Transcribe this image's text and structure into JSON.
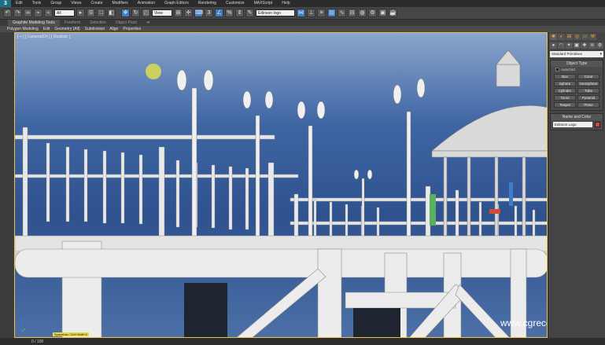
{
  "menubar": {
    "logo": "3",
    "items": [
      "Edit",
      "Tools",
      "Group",
      "Views",
      "Create",
      "Modifiers",
      "Animation",
      "Graph Editors",
      "Rendering",
      "Customize",
      "MAXScript",
      "Help"
    ]
  },
  "toolbar": {
    "selection_filter": "All",
    "reference_coord": "View",
    "named_selection": "Edinson logo"
  },
  "ribbon": {
    "tabs": [
      "Graphite Modeling Tools",
      "Freeform",
      "Selection",
      "Object Paint"
    ],
    "sub_items": [
      "Polygon Modeling",
      "Edit",
      "Geometry (All)",
      "Subdivision",
      "Align",
      "Properties"
    ]
  },
  "viewport": {
    "label": "[ + ] [ Camera004 ] [ Realistic ]",
    "watermark": "www.cgrecord.net",
    "mini_status": "Spacebar / Ctrl+Shift+X"
  },
  "command_panel": {
    "dropdown": "Standard Primitives",
    "object_type_title": "Object Type",
    "autogrid_label": "AutoGrid",
    "object_buttons": [
      "Box",
      "Cone",
      "Sphere",
      "GeoSphere",
      "Cylinder",
      "Tube",
      "Torus",
      "Pyramid",
      "Teapot",
      "Plane"
    ],
    "name_color_title": "Name and Color",
    "name_value": "Edinson Logo",
    "accent_color": "#d04a3a"
  },
  "statusbar": {
    "frame": "0 / 100"
  },
  "colors": {
    "viewport_border": "#f0c040",
    "sky_top": "#8aa5cc",
    "sky_mid": "#2f528f",
    "structure": "#f2f2f2"
  }
}
